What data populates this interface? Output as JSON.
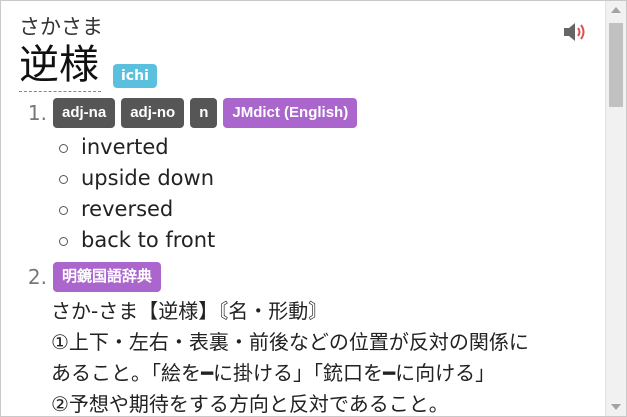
{
  "entry": {
    "reading": "さかさま",
    "expression": "逆様",
    "frequency_tag": "ichi"
  },
  "senses": [
    {
      "number": "1.",
      "tags": [
        "adj-na",
        "adj-no",
        "n"
      ],
      "dictionary": "JMdict (English)",
      "glosses": [
        "inverted",
        "upside down",
        "reversed",
        "back to front"
      ]
    },
    {
      "number": "2.",
      "dictionary": "明鏡国語辞典",
      "lines": [
        "さか-さま【逆様】〘名・形動〙",
        "①上下・左右・表裏・前後などの位置が反対の関係に",
        "あること。「絵を━に掛ける」「銃口を━に向ける」",
        "②予想や期待をする方向と反対であること。"
      ]
    }
  ],
  "colors": {
    "pos_tag": "#565656",
    "dict_tag": "#aa66cc",
    "freq_tag": "#5bc0de",
    "audio_wave": "#d9534f"
  },
  "icons": {
    "audio": "speaker-icon"
  }
}
